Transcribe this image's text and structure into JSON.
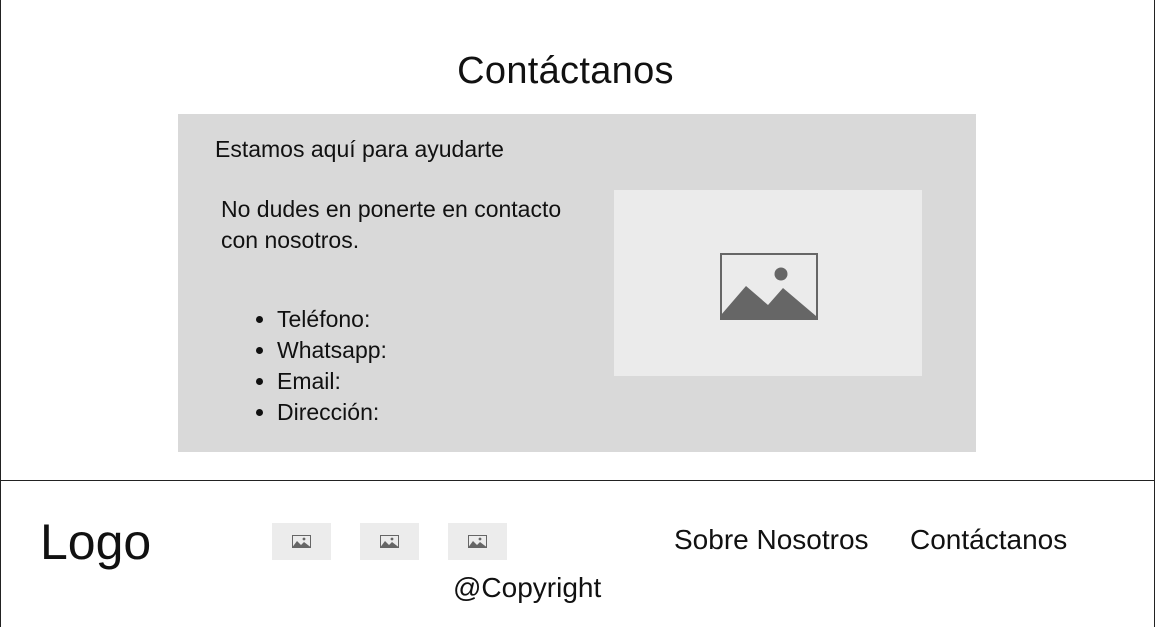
{
  "main": {
    "title": "Contáctanos",
    "card": {
      "heading": "Estamos aquí para ayudarte",
      "intro": "No dudes en ponerte en contacto con nosotros.",
      "contact_items": [
        {
          "label": "Teléfono:"
        },
        {
          "label": "Whatsapp:"
        },
        {
          "label": "Email:"
        },
        {
          "label": "Dirección:"
        }
      ],
      "image": {
        "icon": "image-placeholder-icon"
      }
    }
  },
  "footer": {
    "logo": "Logo",
    "social_icons": [
      {
        "icon": "image-placeholder-icon"
      },
      {
        "icon": "image-placeholder-icon"
      },
      {
        "icon": "image-placeholder-icon"
      }
    ],
    "links": [
      {
        "label": "Sobre Nosotros"
      },
      {
        "label": "Contáctanos"
      }
    ],
    "copyright": "@Copyright"
  },
  "colors": {
    "card_background": "#d9d9d9",
    "placeholder_background": "#ebebeb",
    "placeholder_icon": "#666666",
    "border": "#222222"
  }
}
